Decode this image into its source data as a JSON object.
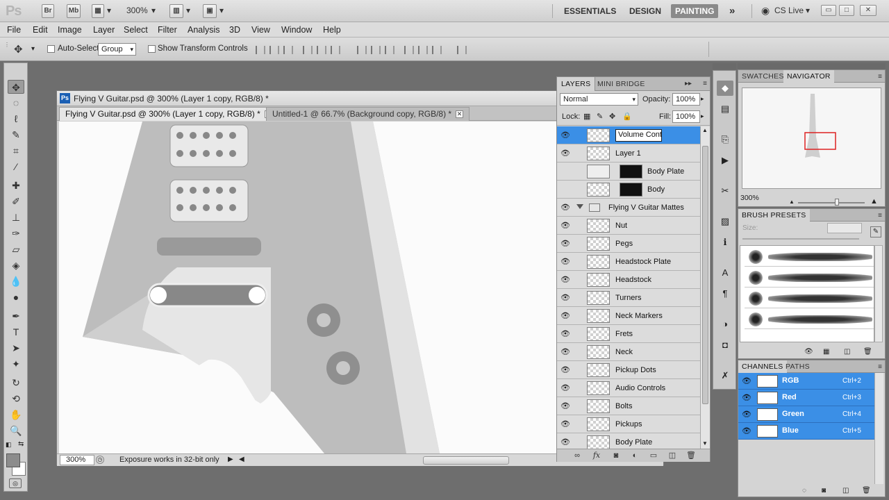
{
  "app_bar": {
    "logo": "Ps",
    "bridge_label": "Br",
    "minibridge_label": "Mb",
    "zoom_value": "300%",
    "workspaces": [
      "ESSENTIALS",
      "DESIGN",
      "PAINTING"
    ],
    "active_workspace": "PAINTING",
    "more": "»",
    "cslive": "CS Live",
    "window_buttons": [
      "▭",
      "□",
      "✕"
    ]
  },
  "menu": [
    "File",
    "Edit",
    "Image",
    "Layer",
    "Select",
    "Filter",
    "Analysis",
    "3D",
    "View",
    "Window",
    "Help"
  ],
  "options_bar": {
    "auto_select_label": "Auto-Select:",
    "auto_select_value": "Group",
    "transform_label": "Show Transform Controls"
  },
  "document": {
    "title": "Flying V Guitar.psd @ 300% (Layer 1 copy, RGB/8) *",
    "tabs": [
      {
        "label": "Flying V Guitar.psd @ 300% (Layer 1 copy, RGB/8) *",
        "active": true
      },
      {
        "label": "Untitled-1 @ 66.7% (Background copy, RGB/8) *",
        "active": false
      }
    ],
    "zoom": "300%",
    "status": "Exposure works in 32-bit only"
  },
  "layers_panel": {
    "tabs": [
      "LAYERS",
      "MINI BRIDGE"
    ],
    "blend_mode": "Normal",
    "opacity_label": "Opacity:",
    "opacity_value": "100%",
    "lock_label": "Lock:",
    "fill_label": "Fill:",
    "fill_value": "100%",
    "layers": [
      {
        "name": "Volume Cont",
        "visible": true,
        "selected": true,
        "editing": true,
        "masked": false
      },
      {
        "name": "Layer 1",
        "visible": true,
        "selected": false,
        "masked": false
      },
      {
        "name": "Body Plate",
        "visible": false,
        "selected": false,
        "masked": true
      },
      {
        "name": "Body",
        "visible": false,
        "selected": false,
        "masked": true
      },
      {
        "name": "Flying V Guitar Mattes",
        "visible": true,
        "group": true
      },
      {
        "name": "Nut",
        "visible": true
      },
      {
        "name": "Pegs",
        "visible": true
      },
      {
        "name": "Headstock Plate",
        "visible": true
      },
      {
        "name": "Headstock",
        "visible": true
      },
      {
        "name": "Turners",
        "visible": true
      },
      {
        "name": "Neck Markers",
        "visible": true
      },
      {
        "name": "Frets",
        "visible": true
      },
      {
        "name": "Neck",
        "visible": true
      },
      {
        "name": "Pickup Dots",
        "visible": true
      },
      {
        "name": "Audio Controls",
        "visible": true
      },
      {
        "name": "Bolts",
        "visible": true
      },
      {
        "name": "Pickups",
        "visible": true
      },
      {
        "name": "Body Plate",
        "visible": true
      }
    ]
  },
  "navigator_panel": {
    "tabs": [
      "SWATCHES",
      "NAVIGATOR"
    ],
    "zoom": "300%"
  },
  "brush_presets_panel": {
    "title": "BRUSH PRESETS",
    "size_label": "Size:"
  },
  "channels_panel": {
    "tabs": [
      "CHANNELS",
      "PATHS"
    ],
    "channels": [
      {
        "name": "RGB",
        "shortcut": "Ctrl+2"
      },
      {
        "name": "Red",
        "shortcut": "Ctrl+3"
      },
      {
        "name": "Green",
        "shortcut": "Ctrl+4"
      },
      {
        "name": "Blue",
        "shortcut": "Ctrl+5"
      }
    ]
  }
}
